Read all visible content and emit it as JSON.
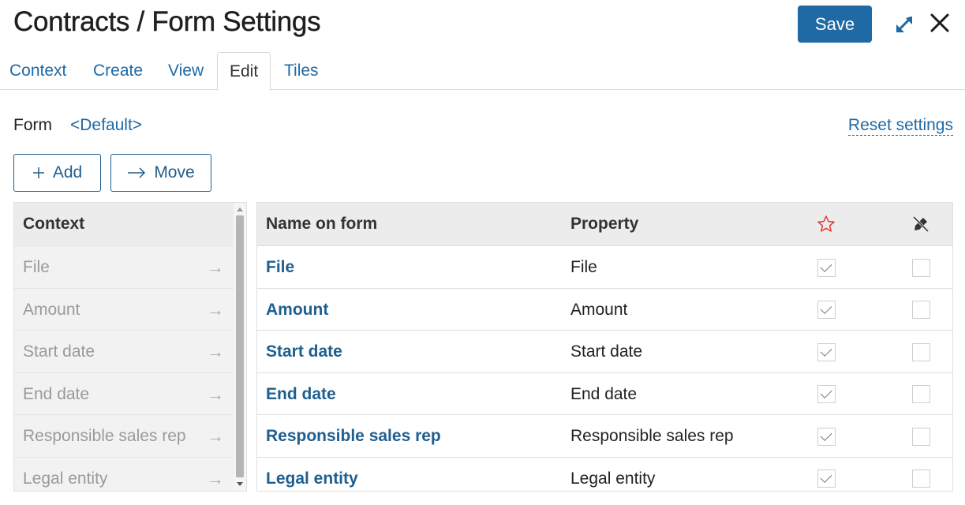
{
  "header": {
    "title": "Contracts / Form Settings",
    "save_label": "Save"
  },
  "tabs": [
    {
      "label": "Context",
      "active": false
    },
    {
      "label": "Create",
      "active": false
    },
    {
      "label": "View",
      "active": false
    },
    {
      "label": "Edit",
      "active": true
    },
    {
      "label": "Tiles",
      "active": false
    }
  ],
  "form": {
    "label": "Form",
    "value": "<Default>",
    "reset_label": "Reset settings"
  },
  "toolbar": {
    "add_label": "Add",
    "move_label": "Move"
  },
  "context_panel": {
    "header": "Context",
    "items": [
      "File",
      "Amount",
      "Start date",
      "End date",
      "Responsible sales rep",
      "Legal entity"
    ]
  },
  "fields_table": {
    "columns": {
      "name": "Name on form",
      "property": "Property",
      "required_icon": "star-outline-icon",
      "readonly_icon": "pencil-off-icon"
    },
    "rows": [
      {
        "name": "File",
        "property": "File",
        "required": true,
        "readonly": false
      },
      {
        "name": "Amount",
        "property": "Amount",
        "required": true,
        "readonly": false
      },
      {
        "name": "Start date",
        "property": "Start date",
        "required": true,
        "readonly": false
      },
      {
        "name": "End date",
        "property": "End date",
        "required": true,
        "readonly": false
      },
      {
        "name": "Responsible sales rep",
        "property": "Responsible sales rep",
        "required": true,
        "readonly": false
      },
      {
        "name": "Legal entity",
        "property": "Legal entity",
        "required": true,
        "readonly": false
      }
    ]
  },
  "colors": {
    "accent": "#1f6aa5",
    "required_star": "#e53935"
  }
}
